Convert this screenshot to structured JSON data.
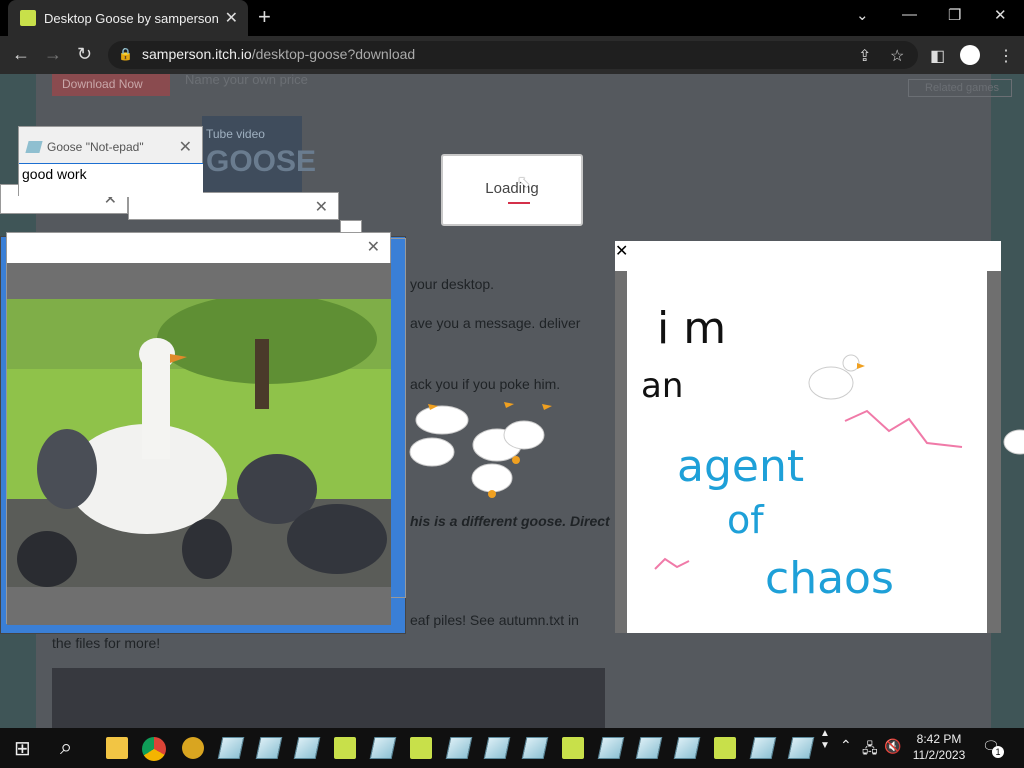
{
  "browser": {
    "tab_title": "Desktop Goose by samperson",
    "url_host": "samperson.itch.io",
    "url_path": "/desktop-goose?download"
  },
  "page": {
    "download_label": "Download Now",
    "name_price": "Name your own price",
    "related_games": "Related games",
    "yt_label": "Tube video",
    "yt_big": "GOOSE",
    "lines": [
      "your desktop.",
      "ave you a message. deliver",
      "ack you if you poke him.",
      "his is a different goose. Direct",
      "eaf piles! See autumn.txt in",
      "the files for more!"
    ]
  },
  "notepad": {
    "title": "Goose \"Not-epad\"",
    "text": "good work"
  },
  "loading": {
    "text": "Loading"
  },
  "drawing": {
    "words": [
      "i m",
      "an",
      "agent",
      "of",
      "chaos"
    ]
  },
  "taskbar": {
    "time": "8:42 PM",
    "date": "11/2/2023",
    "notif_count": "1"
  },
  "icons": {
    "close": "close-icon",
    "search": "search-icon",
    "windows": "windows-start-icon"
  },
  "colors": {
    "accent_red": "#d4304a",
    "goose_green": "#c8e04a",
    "marker_blue": "#1ea0d8",
    "marker_pink": "#f07aa8"
  }
}
